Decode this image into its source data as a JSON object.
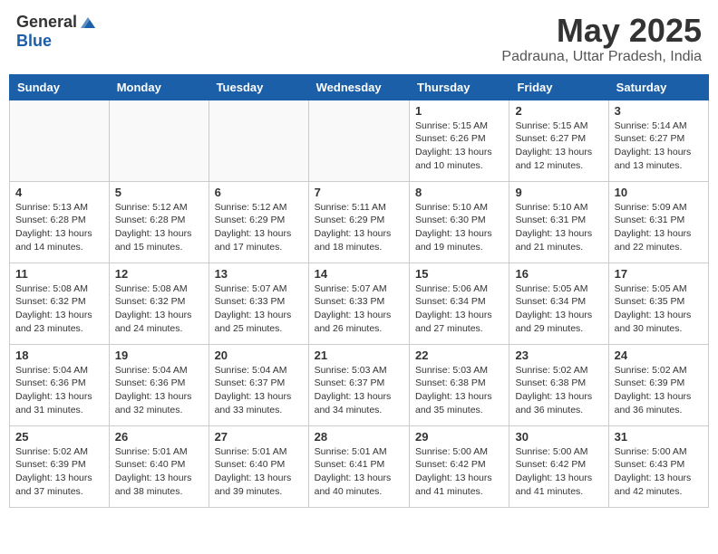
{
  "header": {
    "logo_general": "General",
    "logo_blue": "Blue",
    "month_title": "May 2025",
    "location": "Padrauna, Uttar Pradesh, India"
  },
  "weekdays": [
    "Sunday",
    "Monday",
    "Tuesday",
    "Wednesday",
    "Thursday",
    "Friday",
    "Saturday"
  ],
  "weeks": [
    [
      {
        "day": "",
        "info": ""
      },
      {
        "day": "",
        "info": ""
      },
      {
        "day": "",
        "info": ""
      },
      {
        "day": "",
        "info": ""
      },
      {
        "day": "1",
        "info": "Sunrise: 5:15 AM\nSunset: 6:26 PM\nDaylight: 13 hours\nand 10 minutes."
      },
      {
        "day": "2",
        "info": "Sunrise: 5:15 AM\nSunset: 6:27 PM\nDaylight: 13 hours\nand 12 minutes."
      },
      {
        "day": "3",
        "info": "Sunrise: 5:14 AM\nSunset: 6:27 PM\nDaylight: 13 hours\nand 13 minutes."
      }
    ],
    [
      {
        "day": "4",
        "info": "Sunrise: 5:13 AM\nSunset: 6:28 PM\nDaylight: 13 hours\nand 14 minutes."
      },
      {
        "day": "5",
        "info": "Sunrise: 5:12 AM\nSunset: 6:28 PM\nDaylight: 13 hours\nand 15 minutes."
      },
      {
        "day": "6",
        "info": "Sunrise: 5:12 AM\nSunset: 6:29 PM\nDaylight: 13 hours\nand 17 minutes."
      },
      {
        "day": "7",
        "info": "Sunrise: 5:11 AM\nSunset: 6:29 PM\nDaylight: 13 hours\nand 18 minutes."
      },
      {
        "day": "8",
        "info": "Sunrise: 5:10 AM\nSunset: 6:30 PM\nDaylight: 13 hours\nand 19 minutes."
      },
      {
        "day": "9",
        "info": "Sunrise: 5:10 AM\nSunset: 6:31 PM\nDaylight: 13 hours\nand 21 minutes."
      },
      {
        "day": "10",
        "info": "Sunrise: 5:09 AM\nSunset: 6:31 PM\nDaylight: 13 hours\nand 22 minutes."
      }
    ],
    [
      {
        "day": "11",
        "info": "Sunrise: 5:08 AM\nSunset: 6:32 PM\nDaylight: 13 hours\nand 23 minutes."
      },
      {
        "day": "12",
        "info": "Sunrise: 5:08 AM\nSunset: 6:32 PM\nDaylight: 13 hours\nand 24 minutes."
      },
      {
        "day": "13",
        "info": "Sunrise: 5:07 AM\nSunset: 6:33 PM\nDaylight: 13 hours\nand 25 minutes."
      },
      {
        "day": "14",
        "info": "Sunrise: 5:07 AM\nSunset: 6:33 PM\nDaylight: 13 hours\nand 26 minutes."
      },
      {
        "day": "15",
        "info": "Sunrise: 5:06 AM\nSunset: 6:34 PM\nDaylight: 13 hours\nand 27 minutes."
      },
      {
        "day": "16",
        "info": "Sunrise: 5:05 AM\nSunset: 6:34 PM\nDaylight: 13 hours\nand 29 minutes."
      },
      {
        "day": "17",
        "info": "Sunrise: 5:05 AM\nSunset: 6:35 PM\nDaylight: 13 hours\nand 30 minutes."
      }
    ],
    [
      {
        "day": "18",
        "info": "Sunrise: 5:04 AM\nSunset: 6:36 PM\nDaylight: 13 hours\nand 31 minutes."
      },
      {
        "day": "19",
        "info": "Sunrise: 5:04 AM\nSunset: 6:36 PM\nDaylight: 13 hours\nand 32 minutes."
      },
      {
        "day": "20",
        "info": "Sunrise: 5:04 AM\nSunset: 6:37 PM\nDaylight: 13 hours\nand 33 minutes."
      },
      {
        "day": "21",
        "info": "Sunrise: 5:03 AM\nSunset: 6:37 PM\nDaylight: 13 hours\nand 34 minutes."
      },
      {
        "day": "22",
        "info": "Sunrise: 5:03 AM\nSunset: 6:38 PM\nDaylight: 13 hours\nand 35 minutes."
      },
      {
        "day": "23",
        "info": "Sunrise: 5:02 AM\nSunset: 6:38 PM\nDaylight: 13 hours\nand 36 minutes."
      },
      {
        "day": "24",
        "info": "Sunrise: 5:02 AM\nSunset: 6:39 PM\nDaylight: 13 hours\nand 36 minutes."
      }
    ],
    [
      {
        "day": "25",
        "info": "Sunrise: 5:02 AM\nSunset: 6:39 PM\nDaylight: 13 hours\nand 37 minutes."
      },
      {
        "day": "26",
        "info": "Sunrise: 5:01 AM\nSunset: 6:40 PM\nDaylight: 13 hours\nand 38 minutes."
      },
      {
        "day": "27",
        "info": "Sunrise: 5:01 AM\nSunset: 6:40 PM\nDaylight: 13 hours\nand 39 minutes."
      },
      {
        "day": "28",
        "info": "Sunrise: 5:01 AM\nSunset: 6:41 PM\nDaylight: 13 hours\nand 40 minutes."
      },
      {
        "day": "29",
        "info": "Sunrise: 5:00 AM\nSunset: 6:42 PM\nDaylight: 13 hours\nand 41 minutes."
      },
      {
        "day": "30",
        "info": "Sunrise: 5:00 AM\nSunset: 6:42 PM\nDaylight: 13 hours\nand 41 minutes."
      },
      {
        "day": "31",
        "info": "Sunrise: 5:00 AM\nSunset: 6:43 PM\nDaylight: 13 hours\nand 42 minutes."
      }
    ]
  ]
}
